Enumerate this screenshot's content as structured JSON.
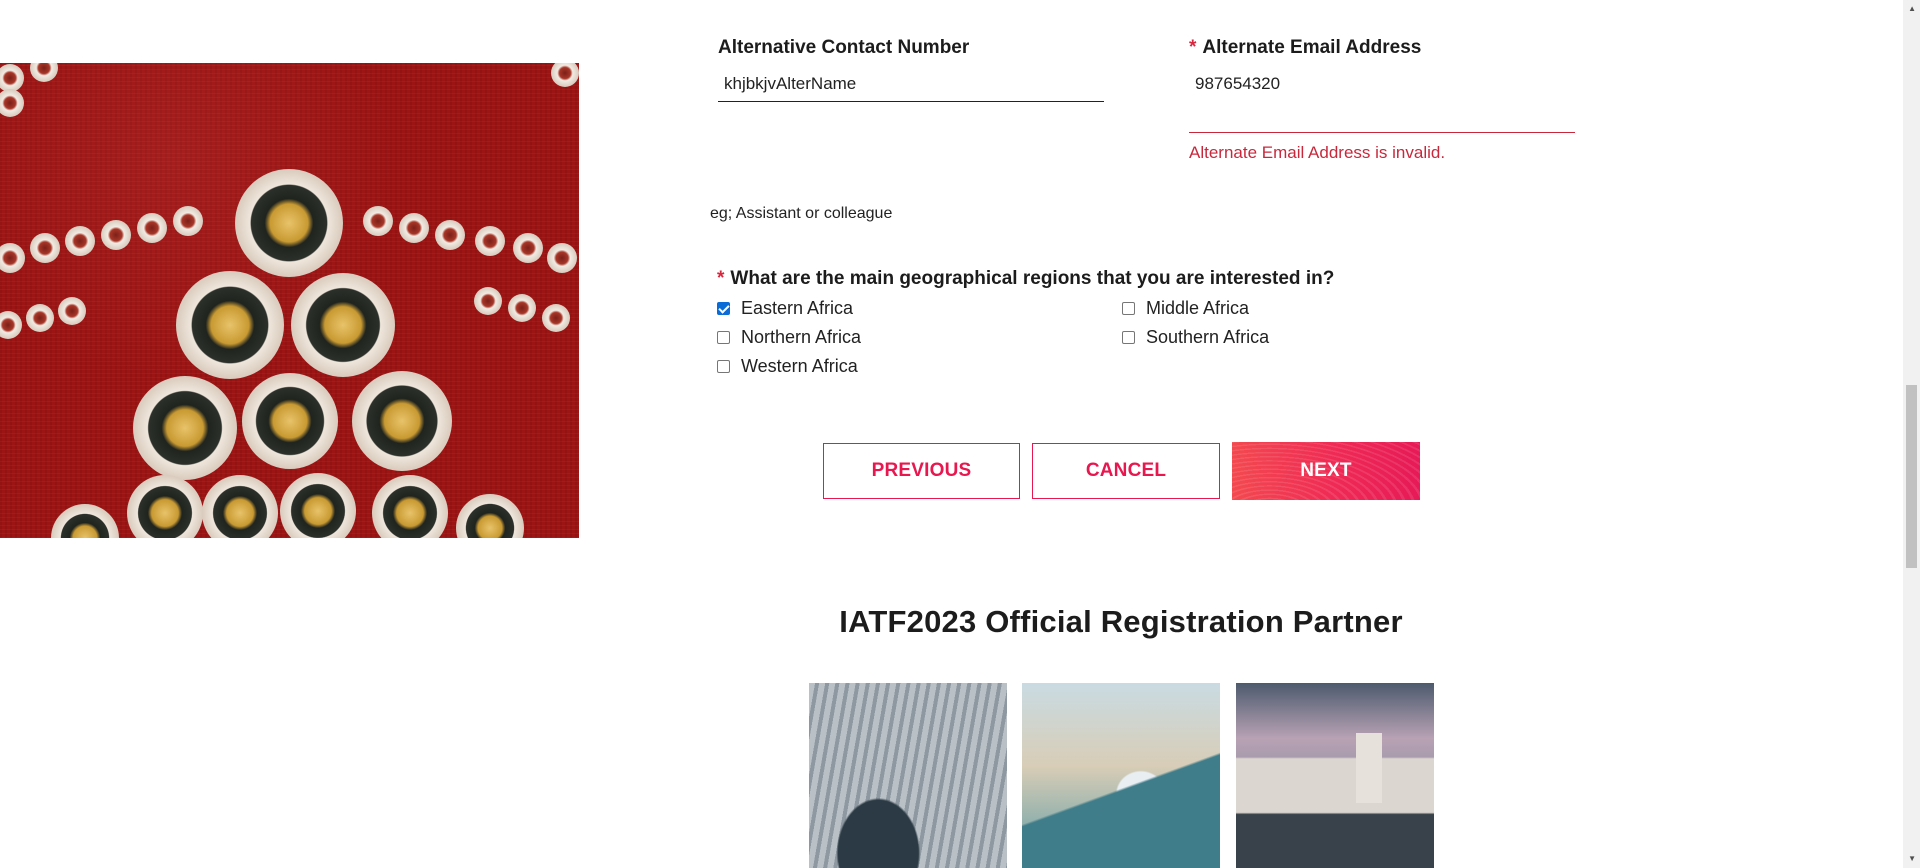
{
  "form": {
    "alt_contact": {
      "label": "Alternative Contact Number",
      "value": "khjbkjvAlterName",
      "required": false
    },
    "alt_email": {
      "required_mark": "*",
      "label": "Alternate Email Address",
      "value": "987654320",
      "error": "Alternate Email Address is invalid.",
      "required": true
    },
    "hint": "eg; Assistant or colleague",
    "regions": {
      "required_mark": "*",
      "question": "What are the main geographical regions that you are interested in?",
      "options": [
        {
          "label": "Eastern Africa",
          "checked": true
        },
        {
          "label": "Middle Africa",
          "checked": false
        },
        {
          "label": "Northern Africa",
          "checked": false
        },
        {
          "label": "Southern Africa",
          "checked": false
        },
        {
          "label": "Western Africa",
          "checked": false
        }
      ]
    }
  },
  "buttons": {
    "previous": "PREVIOUS",
    "cancel": "CANCEL",
    "next": "NEXT"
  },
  "partner": {
    "title": "IATF2023 Official Registration Partner"
  },
  "colors": {
    "accent": "#e8174f",
    "error": "#c8283c",
    "required": "#d7263d",
    "checkbox_checked": "#0a6cd6"
  },
  "scroll": {
    "up_icon": "scroll-up-arrow",
    "down_icon": "scroll-down-arrow"
  }
}
